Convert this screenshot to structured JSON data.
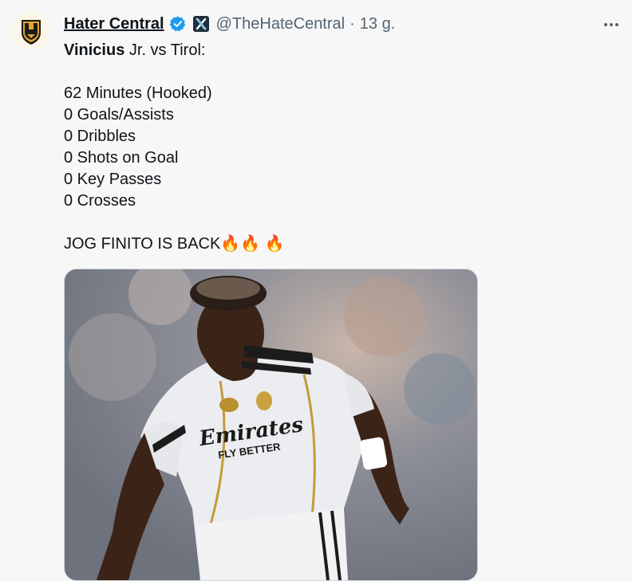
{
  "author": {
    "display_name": "Hater Central",
    "handle": "@TheHateCentral",
    "separator": "·",
    "timestamp": "13 g.",
    "verified_icon": "verified-badge-icon",
    "affiliation_icon": "x-affiliate-icon"
  },
  "tweet": {
    "line1_bold": "Vinicius",
    "line1_rest": " Jr. vs Tirol:",
    "stats": [
      "62 Minutes (Hooked)",
      "0 Goals/Assists",
      "0 Dribbles",
      "0 Shots on Goal",
      "0 Key Passes",
      "0 Crosses"
    ],
    "closing_text": "JOG FINITO IS BACK",
    "closing_emoji": "🔥🔥 🔥"
  },
  "media": {
    "jersey_sponsor": "Emirates",
    "jersey_tagline": "FLY BETTER"
  },
  "colors": {
    "background": "#f7f7f7",
    "text": "#0f1419",
    "secondary": "#536471",
    "verified": "#1d9bf0"
  }
}
